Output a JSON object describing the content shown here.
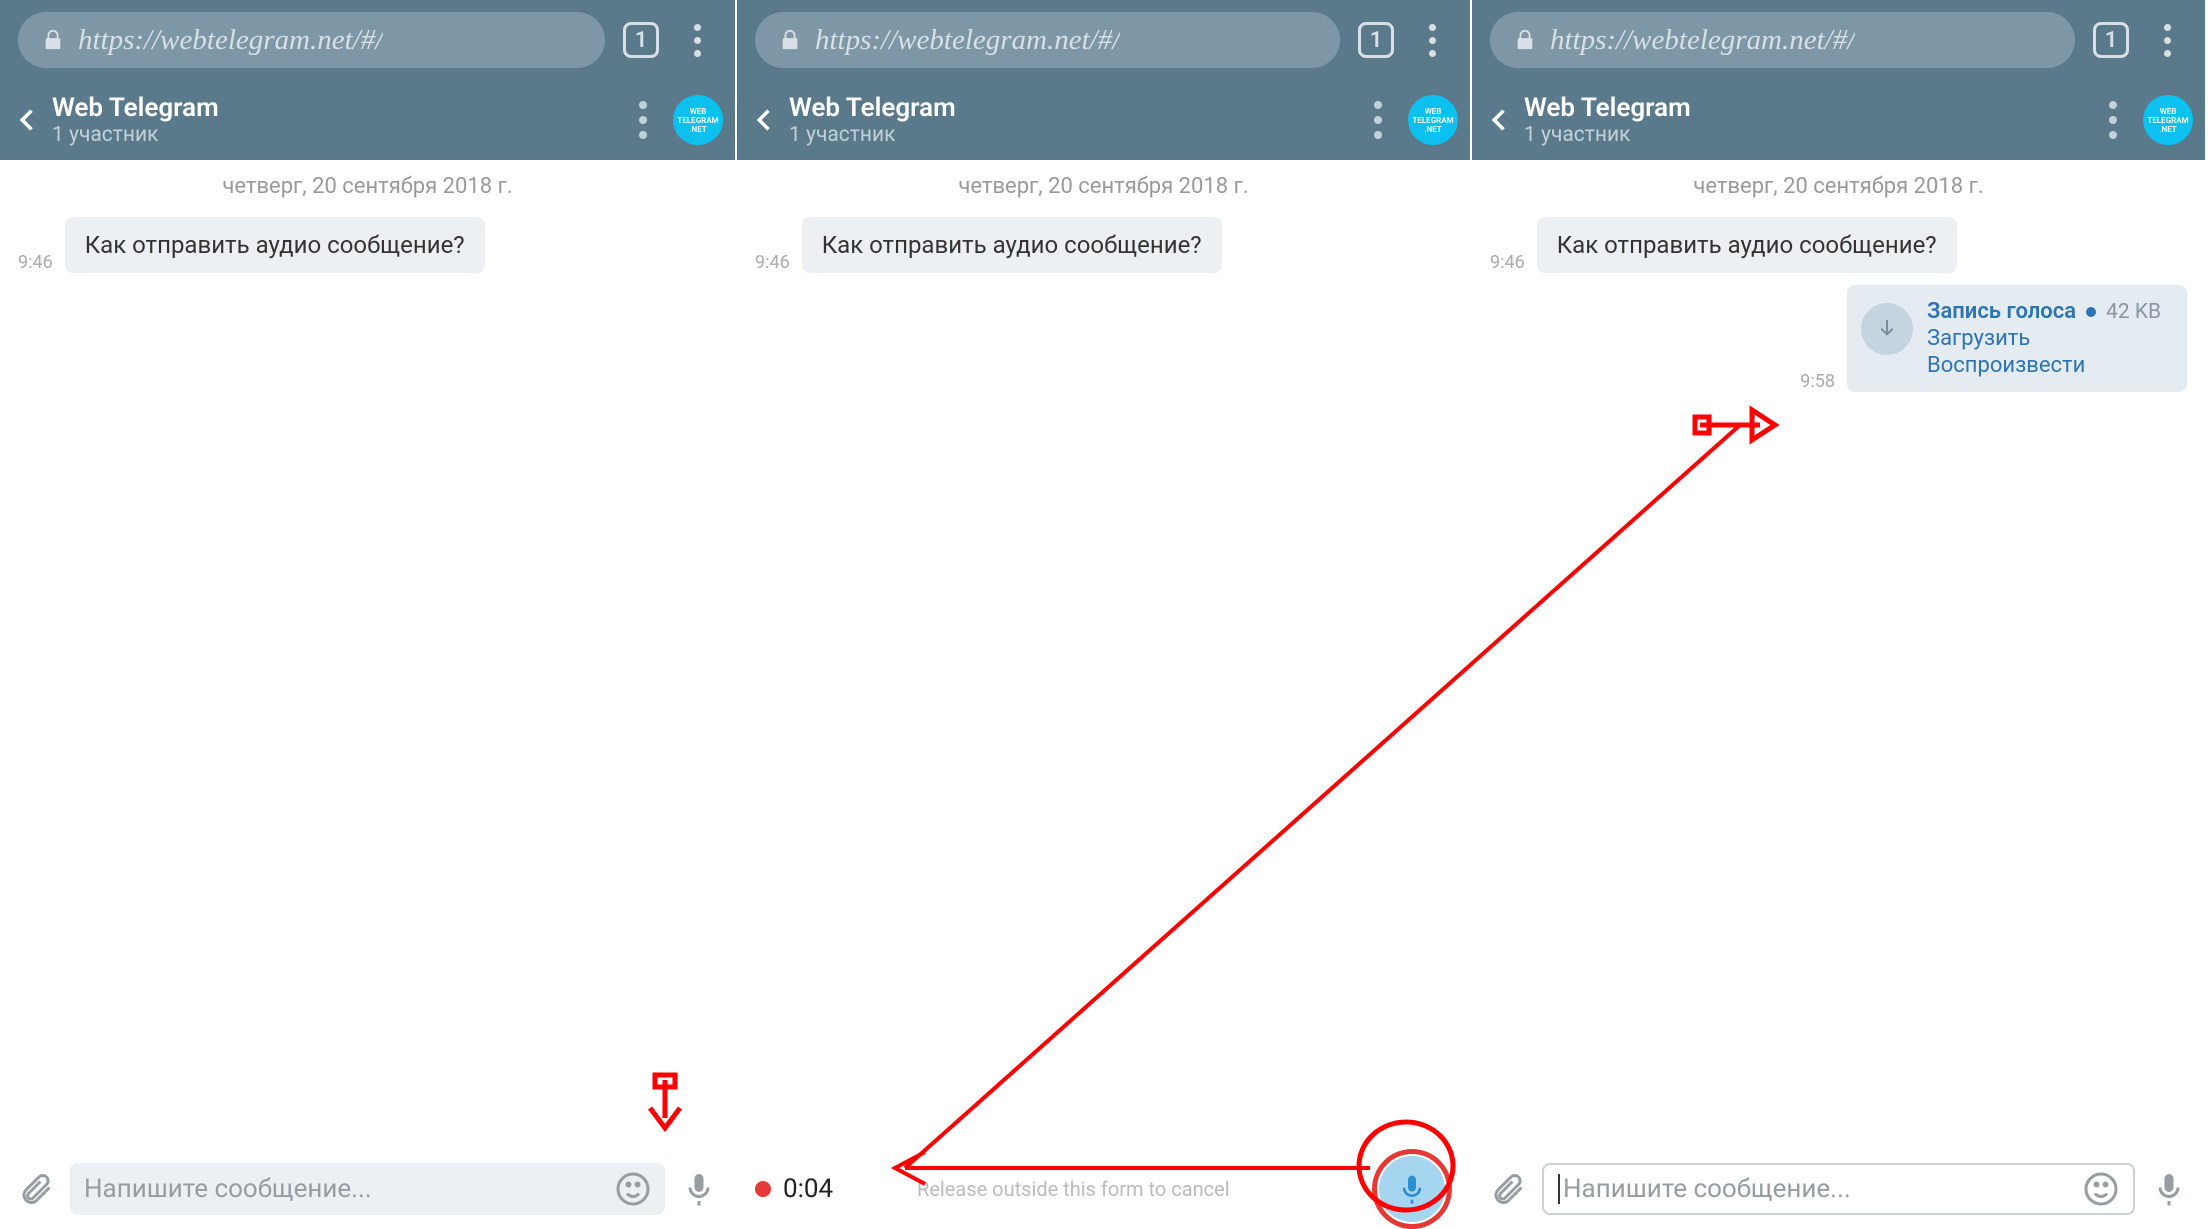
{
  "browser": {
    "url": "https://webtelegram.net/#/",
    "tab_count": "1"
  },
  "header": {
    "title": "Web Telegram",
    "subtitle": "1 участник",
    "avatar_text1": "WEB",
    "avatar_text2": "TELEGRAM",
    "avatar_text3": ".NET"
  },
  "chat": {
    "date_divider": "четверг, 20 сентября 2018 г.",
    "msg1_time": "9:46",
    "msg1_text": "Как отправить аудио сообщение?",
    "voice_time": "9:58",
    "voice_title": "Запись голоса",
    "voice_size": "42 KB",
    "voice_link1": "Загрузить",
    "voice_link2": "Воспроизвести"
  },
  "input": {
    "placeholder": "Напишите сообщение..."
  },
  "recording": {
    "time": "0:04",
    "hint": "Release outside this form to cancel"
  }
}
